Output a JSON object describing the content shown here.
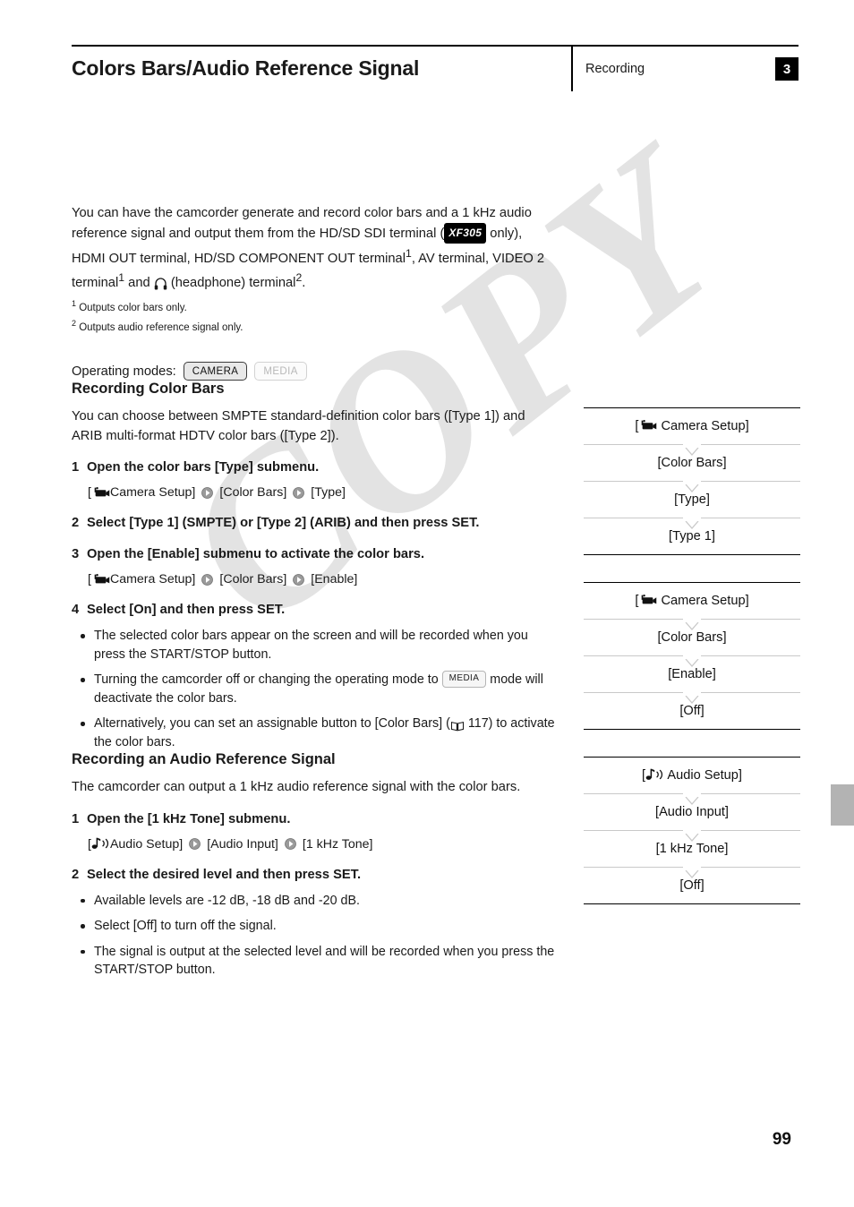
{
  "header": {
    "title": "Colors Bars/Audio Reference Signal",
    "section": "Recording",
    "chapter": "3"
  },
  "intro": {
    "line_a": "You can have the camcorder generate and record color bars and a 1 kHz",
    "line_b": "audio reference signal and output them from the HD/SD SDI terminal",
    "model_badge": "XF305",
    "line_c_before": "(",
    "line_c_after": " only), HDMI OUT terminal, HD/SD COMPONENT OUT",
    "line_d_1": "terminal",
    "line_d_sup1": "1",
    "line_d_2": ", AV terminal, VIDEO 2 terminal",
    "line_d_sup2": "1",
    "line_d_3": " and ",
    "line_d_4": " (headphone) terminal",
    "line_d_sup3": "2",
    "line_d_5": ".",
    "footnote_1_marker": "1",
    "footnote_1": "Outputs color bars only.",
    "footnote_2_marker": "2",
    "footnote_2": "Outputs audio reference signal only."
  },
  "operating_modes": {
    "label": "Operating modes:",
    "camera": "CAMERA",
    "media": "MEDIA"
  },
  "color_bars": {
    "heading": "Recording Color Bars",
    "intro_1": "You can choose between SMPTE standard-definition color bars ([Type 1])",
    "intro_2": "and ARIB multi-format HDTV color bars ([Type 2]).",
    "step1_num": "1",
    "step1_text": "Open the color bars [Type] submenu.",
    "path1": {
      "a_open": "[",
      "a_label": " Camera Setup]",
      "b": "[Color Bars]",
      "c": "[Type]"
    },
    "step2_num": "2",
    "step2_text": "Select [Type 1] (SMPTE) or [Type 2] (ARIB) and then press SET.",
    "step3_num": "3",
    "step3_text": "Open the [Enable] submenu to activate the color bars.",
    "path2": {
      "a_open": "[",
      "a_label": " Camera Setup]",
      "b": "[Color Bars]",
      "c": "[Enable]"
    },
    "step4_num": "4",
    "step4_text": "Select [On] and then press SET.",
    "bullet1_a": "The selected color bars appear on the screen and will be recorded",
    "bullet1_b": "when you press the START/STOP button.",
    "bullet2_a": "Turning the camcorder off or changing the operating mode to ",
    "bullet2_pill": "MEDIA",
    "bullet2_b": "mode will deactivate the color bars.",
    "bullet3_a": "Alternatively, you can set an assignable button to [Color Bars]",
    "bullet3_b_open": "(",
    "bullet3_page": " 117) to activate the color bars."
  },
  "audio": {
    "heading": "Recording an Audio Reference Signal",
    "intro_1": "The camcorder can output a 1 kHz audio reference signal with the color",
    "intro_2": "bars.",
    "step1_num": "1",
    "step1_text": "Open the [1 kHz Tone] submenu.",
    "path1": {
      "a_open": "[",
      "a_label": " Audio Setup]",
      "b": "[Audio Input]",
      "c": "[1 kHz Tone]"
    },
    "step2_num": "2",
    "step2_text": "Select the desired level and then press SET.",
    "bullet1": "Available levels are -12 dB, -18 dB and -20 dB.",
    "bullet2": "Select [Off] to turn off the signal.",
    "bullet3_a": "The signal is output at the selected level and will be recorded when",
    "bullet3_b": "you press the START/STOP button."
  },
  "panels": [
    {
      "name": "color-bars-type-panel",
      "rows": [
        "[  Camera Setup]",
        "[Color Bars]",
        "[Type]",
        "[Type 1]"
      ],
      "row0_prefix": "[",
      "row0_suffix": " Camera Setup]"
    },
    {
      "name": "color-bars-enable-panel",
      "rows": [
        "[ Camera Setup]",
        "[Color Bars]",
        "[Enable]",
        "[Off]"
      ],
      "row0_prefix": "[",
      "row0_suffix": " Camera Setup]"
    },
    {
      "name": "audio-tone-panel",
      "rows": [
        "[ Audio Setup]",
        "[Audio Input]",
        "[1 kHz Tone]",
        "[Off]"
      ],
      "row0_prefix": "[",
      "row0_suffix": " Audio Setup]"
    }
  ],
  "panel_rows": {
    "p1r1": "[Color Bars]",
    "p1r2": "[Type]",
    "p1r3": "[Type 1]",
    "p2r1": "[Color Bars]",
    "p2r2": "[Enable]",
    "p2r3": "[Off]",
    "p3r1": "[Audio Input]",
    "p3r2": "[1 kHz Tone]",
    "p3r3": "[Off]",
    "camera_setup_label": " Camera Setup]",
    "audio_setup_label": " Audio Setup]",
    "bracket_open": "["
  },
  "watermark": "COPY",
  "page_number": "99"
}
